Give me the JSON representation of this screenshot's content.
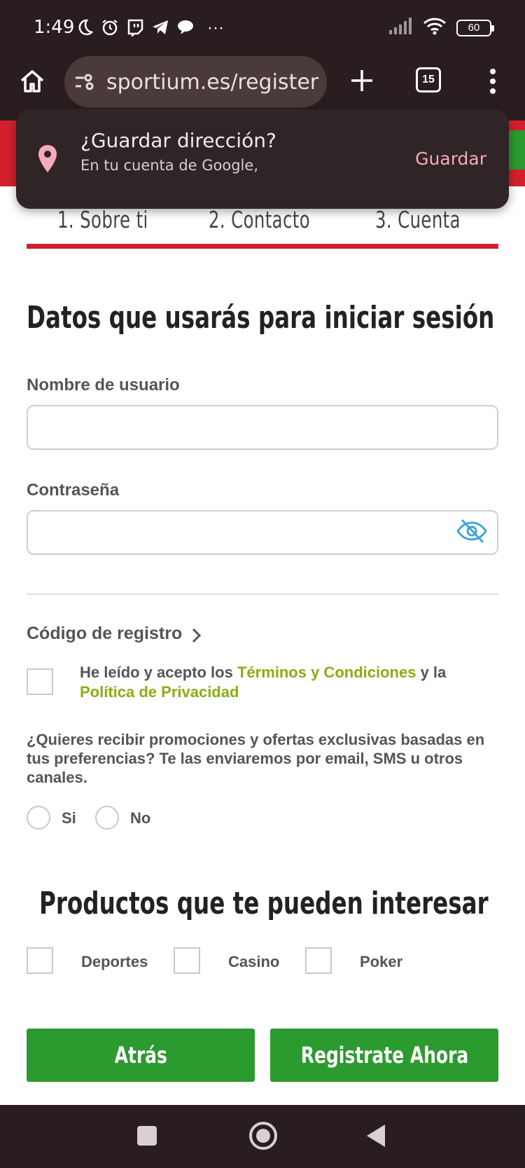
{
  "status_bar": {
    "time": "1:49",
    "more": "···",
    "battery": "60"
  },
  "browser": {
    "url": "sportium.es/register",
    "tabs_count": "15"
  },
  "popup": {
    "title": "¿Guardar dirección?",
    "subtitle": "En tu cuenta de Google,",
    "action": "Guardar"
  },
  "steps": [
    {
      "label": "1. Sobre ti"
    },
    {
      "label": "2. Contacto"
    },
    {
      "label": "3. Cuenta"
    }
  ],
  "form": {
    "heading": "Datos que usarás para iniciar sesión",
    "username_label": "Nombre de usuario",
    "username_value": "",
    "password_label": "Contraseña",
    "password_value": "",
    "registration_code": "Código de registro",
    "terms_prefix": "He leído y acepto los ",
    "terms_link": "Términos y Condiciones",
    "terms_middle": " y la ",
    "privacy_link": "Política de Privacidad",
    "promo_question": "¿Quieres recibir promociones y ofertas exclusivas basadas en tus preferencias? Te las enviaremos por email, SMS u otros canales.",
    "radio_yes": "Si",
    "radio_no": "No",
    "products_heading": "Productos que te pueden interesar",
    "products": [
      "Deportes",
      "Casino",
      "Poker"
    ],
    "back_button": "Atrás",
    "register_button": "Registrate Ahora"
  },
  "colors": {
    "brand_red": "#d41f2b",
    "brand_green": "#2b9a2f",
    "link_green": "#8aad14",
    "chrome_dark": "#2a1d1f"
  }
}
